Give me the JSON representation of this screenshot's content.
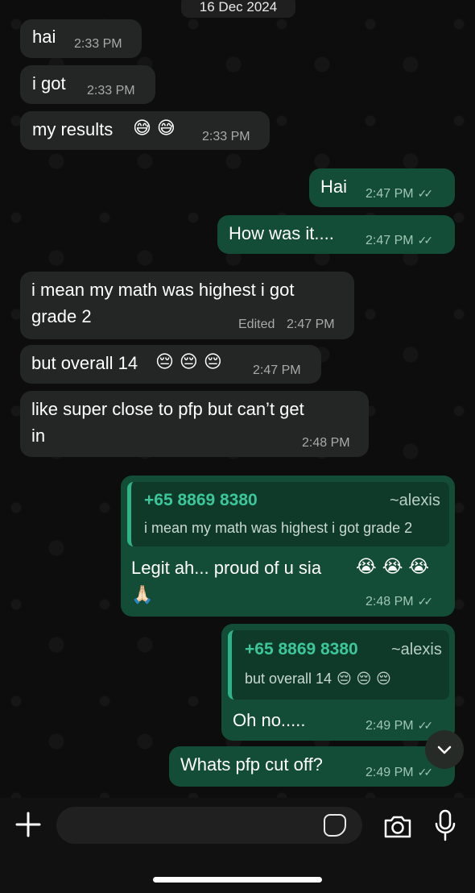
{
  "date_label": "16 Dec 2024",
  "messages": [
    {
      "text": "hai",
      "time": "2:33 PM"
    },
    {
      "text": "i got",
      "time": "2:33 PM"
    },
    {
      "text": "my results",
      "emoji": "😅 😅",
      "time": "2:33 PM"
    },
    {
      "text": "Hai",
      "time": "2:47 PM"
    },
    {
      "text": "How was it....",
      "time": "2:47 PM"
    },
    {
      "line1": "i mean my math was highest i got",
      "line2": "grade 2",
      "edited": "Edited",
      "time": "2:47 PM"
    },
    {
      "text": "but overall 14",
      "emoji": "😔 😔 😔",
      "time": "2:47 PM"
    },
    {
      "line1": "like super close to pfp but can’t get",
      "line2": "in",
      "time": "2:48 PM"
    },
    {
      "quote_phone": "+65 8869 8380",
      "quote_name": "~alexis",
      "quote_text": "i mean my math was highest i got grade 2",
      "text": "Legit ah... proud of u sia",
      "emoji": "😭 😭 😭",
      "emoji2": "🙏🏻",
      "time": "2:48 PM"
    },
    {
      "quote_phone": "+65 8869 8380",
      "quote_name": "~alexis",
      "quote_text": "but overall 14",
      "quote_emoji": "😔 😔 😔",
      "text": "Oh no.....",
      "time": "2:49 PM"
    },
    {
      "text": "Whats pfp cut off?",
      "time": "2:49 PM"
    }
  ],
  "icons": {
    "read_ticks": "✓✓",
    "scroll_down": "chevron-down-icon",
    "add": "plus-icon",
    "sticker": "sticker-icon",
    "camera": "camera-icon",
    "mic": "microphone-icon"
  },
  "colors": {
    "incoming_bubble": "#242626",
    "outgoing_bubble": "#144d37",
    "quote_accent": "#2fb388",
    "quote_phone": "#3cc79a"
  }
}
